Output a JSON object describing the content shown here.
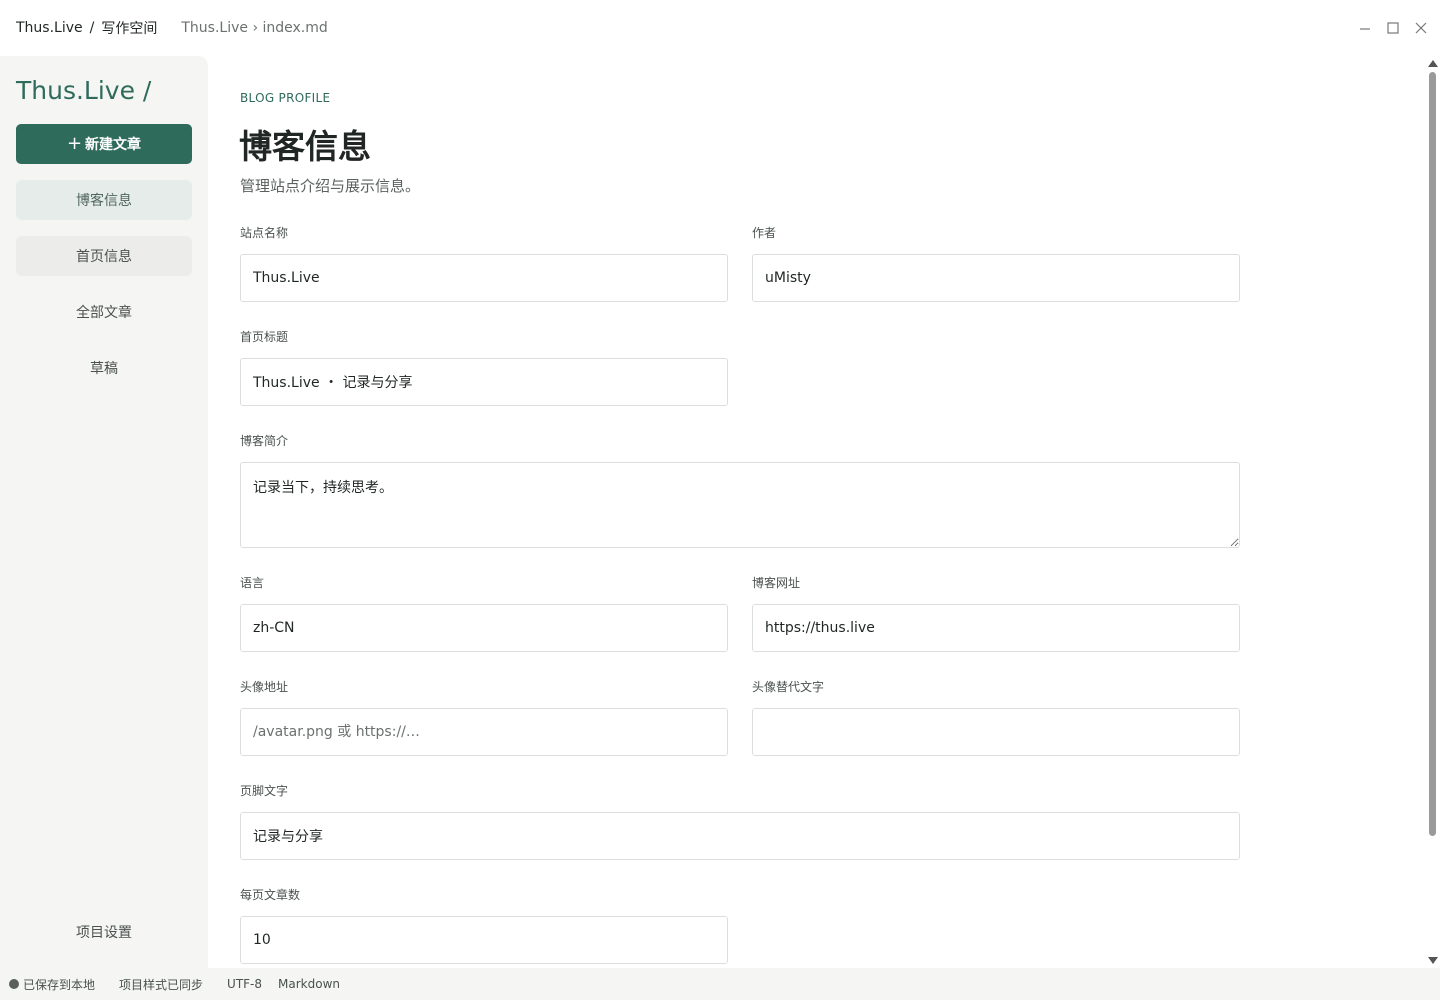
{
  "titlebar": {
    "app_name": "Thus.Live",
    "separator": "/",
    "workspace": "写作空间",
    "path": "Thus.Live › index.md"
  },
  "window_controls": {
    "minimize_icon": "minimize-icon",
    "maximize_icon": "maximize-icon",
    "close_icon": "close-icon"
  },
  "sidebar": {
    "brand": "Thus.Live /",
    "new_button": {
      "icon": "+",
      "label": "新建文章"
    },
    "items": [
      {
        "label": "博客信息",
        "state": "active"
      },
      {
        "label": "首页信息",
        "state": "hover"
      },
      {
        "label": "全部文章",
        "state": "normal"
      },
      {
        "label": "草稿",
        "state": "normal"
      }
    ],
    "settings_label": "项目设置"
  },
  "main": {
    "eyebrow": "BLOG PROFILE",
    "title": "博客信息",
    "subtitle": "管理站点介绍与展示信息。",
    "fields": {
      "site_name": {
        "label": "站点名称",
        "value": "Thus.Live"
      },
      "author": {
        "label": "作者",
        "value": "uMisty"
      },
      "home_title": {
        "label": "首页标题",
        "value": "Thus.Live ・ 记录与分享"
      },
      "description": {
        "label": "博客简介",
        "value": "记录当下，持续思考。"
      },
      "language": {
        "label": "语言",
        "value": "zh-CN"
      },
      "blog_url": {
        "label": "博客网址",
        "value": "https://thus.live"
      },
      "avatar_url": {
        "label": "头像地址",
        "value": "",
        "placeholder": "/avatar.png 或 https://…"
      },
      "avatar_alt": {
        "label": "头像替代文字",
        "value": ""
      },
      "footer_text": {
        "label": "页脚文字",
        "value": "记录与分享"
      },
      "posts_per_page": {
        "label": "每页文章数",
        "value": "10"
      }
    }
  },
  "statusbar": {
    "saved": "已保存到本地",
    "style_sync": "项目样式已同步",
    "encoding": "UTF-8",
    "format": "Markdown"
  },
  "colors": {
    "accent": "#2f6b5b",
    "sidebar_bg": "#f5f5f4",
    "active_item_bg": "#e6ece9"
  }
}
